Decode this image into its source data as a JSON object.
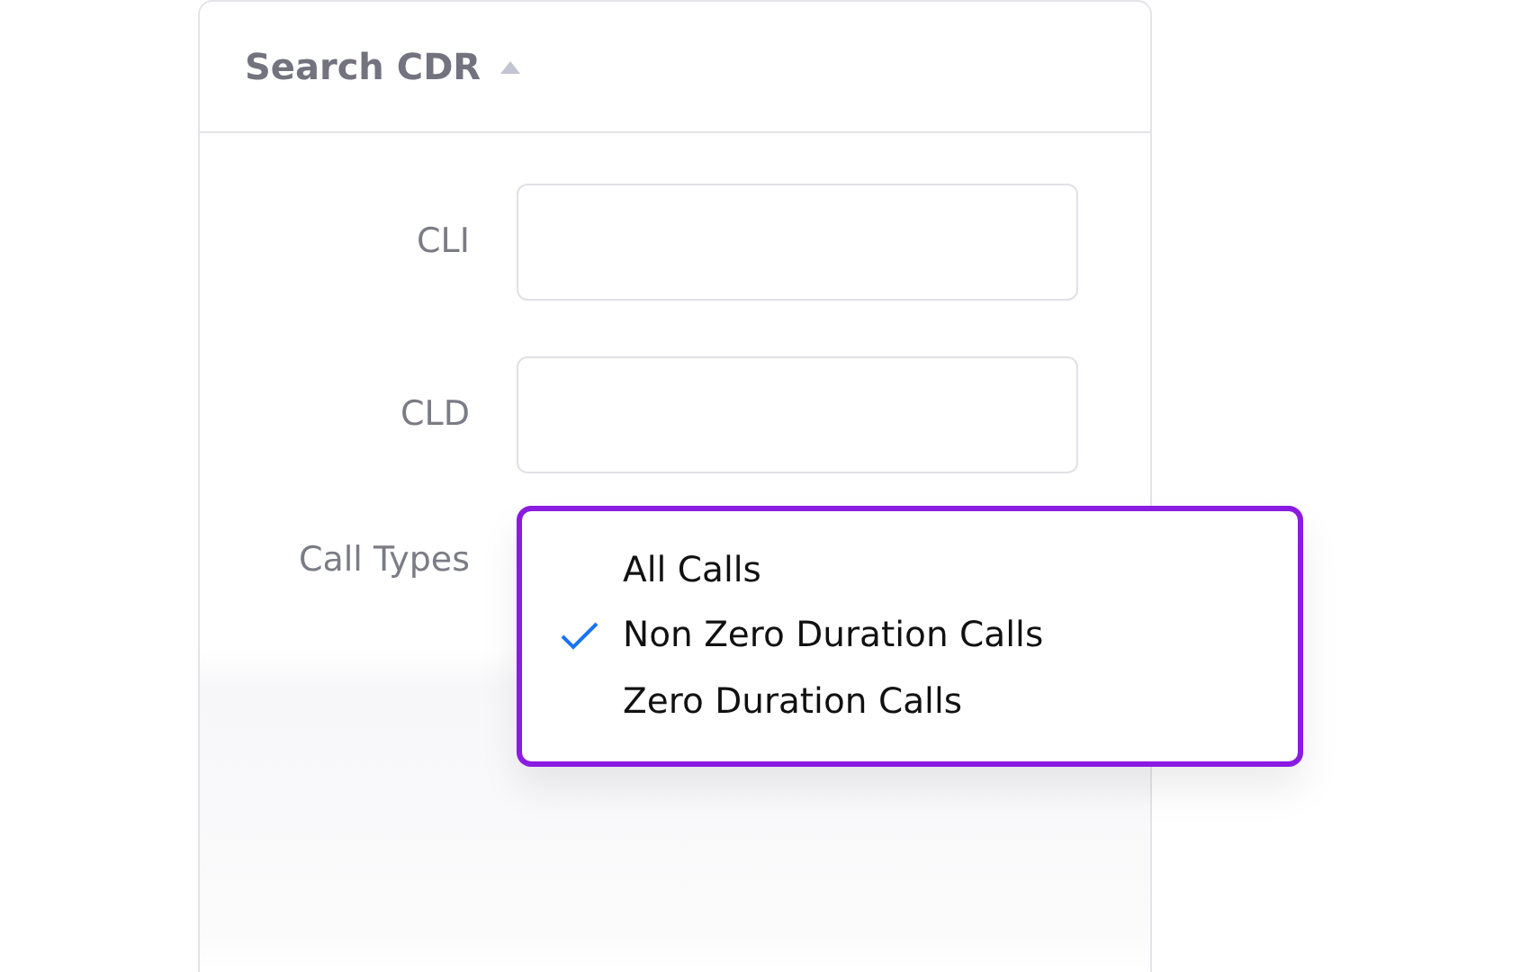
{
  "panel": {
    "title": "Search CDR",
    "expanded": true
  },
  "fields": [
    {
      "label": "CLI"
    },
    {
      "label": "CLD"
    }
  ],
  "call_types": {
    "label": "Call Types",
    "options": [
      {
        "label": "All Calls",
        "selected": false
      },
      {
        "label": "Non Zero Duration Calls",
        "selected": true
      },
      {
        "label": "Zero Duration Calls",
        "selected": false
      }
    ]
  }
}
